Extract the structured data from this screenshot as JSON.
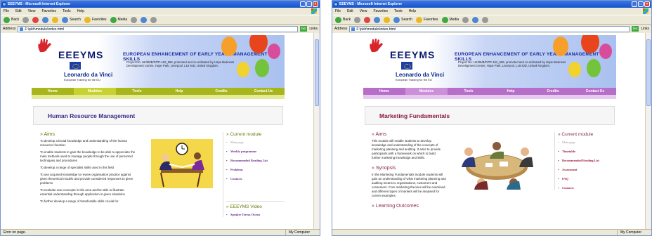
{
  "browser": {
    "title_left": "EEEYMS - Microsoft Internet Explorer",
    "title_right": "EEEYMS - Microsoft Internet Explorer",
    "menu": [
      "File",
      "Edit",
      "View",
      "Favorites",
      "Tools",
      "Help"
    ],
    "toolbar": {
      "back": "Back",
      "search": "Search",
      "favorites": "Favorites",
      "media": "Media"
    },
    "address_label": "Address",
    "address_left": "F:\\pkh\\module\\index.html",
    "address_right": "F:\\pkh\\module\\index.html",
    "go": "Go",
    "links": "Links",
    "status_left": "Error on page.",
    "status_right": "",
    "zone": "My Computer"
  },
  "site": {
    "brand": "EEEYMS",
    "tagline": "EUROPEAN ENHANCEMENT OF EARLY YEARS MANAGEMENT SKILLS",
    "project": "Project No: UK/05/B/F/PP-162_558, promoted and co-ordinated by Hope Business Development Centre, Hope Park, Liverpool, L16 9JD, United Kingdom.",
    "ldv": "Leonardo da Vinci",
    "ldv_sub": "European Training for the EU",
    "nav": [
      "Home",
      "Modules",
      "Tools",
      "Help",
      "Credits",
      "Contact Us"
    ]
  },
  "left": {
    "nav_color": "#a8b61c",
    "accent": "#6a7a0a",
    "page_title": "Human Resource Management",
    "aims_heading": "Aims",
    "aims": [
      "To develop a broad knowledge and understanding of the human resources function.",
      "To enable students to gain the knowledge to be able to appreciate the main methods used to manage people through the use of personnel techniques and procedures",
      "To develop a range of specialist skills used in this field",
      "To use acquired knowledge to review organisation practice against given theoretical models and provide considered responses to given problems",
      "To evaluate new concepts in this area and be able to illustrate essential understanding through application in given situations",
      "To further develop a range of transferable skills crucial for"
    ],
    "current_module": "Current module",
    "module_items": [
      "Main page",
      "Weekly programme",
      "Recommended Reading List",
      "Problems",
      "Contacts"
    ],
    "video_heading": "EEEYMS Video",
    "video_items": [
      "Speaker Teresa Owens"
    ]
  },
  "right": {
    "nav_color": "#b76ec8",
    "accent": "#8a2a4a",
    "page_title": "Marketing Fundamentals",
    "aims_heading": "Aims",
    "aims": [
      "This module will enable students to develop knowledge and understanding of the concepts of marketing planning and auditing. It aims to provide participants with a framework on which to build further marketing knowledge and skills."
    ],
    "synopsis_heading": "Synopsis",
    "synopsis": "In the Marketing Fundamentals module students will gain an understanding of what marketing planning and auditing means to organisations, customers and consumers. Core marketing theories will be examined and different types of markets will be analysed for current examples.",
    "outcomes_heading": "Learning Outcomes",
    "current_module": "Current module",
    "module_items": [
      "Main page",
      "Timetable",
      "Recommended Reading List",
      "Assessment",
      "FAQ",
      "Contacts"
    ]
  }
}
